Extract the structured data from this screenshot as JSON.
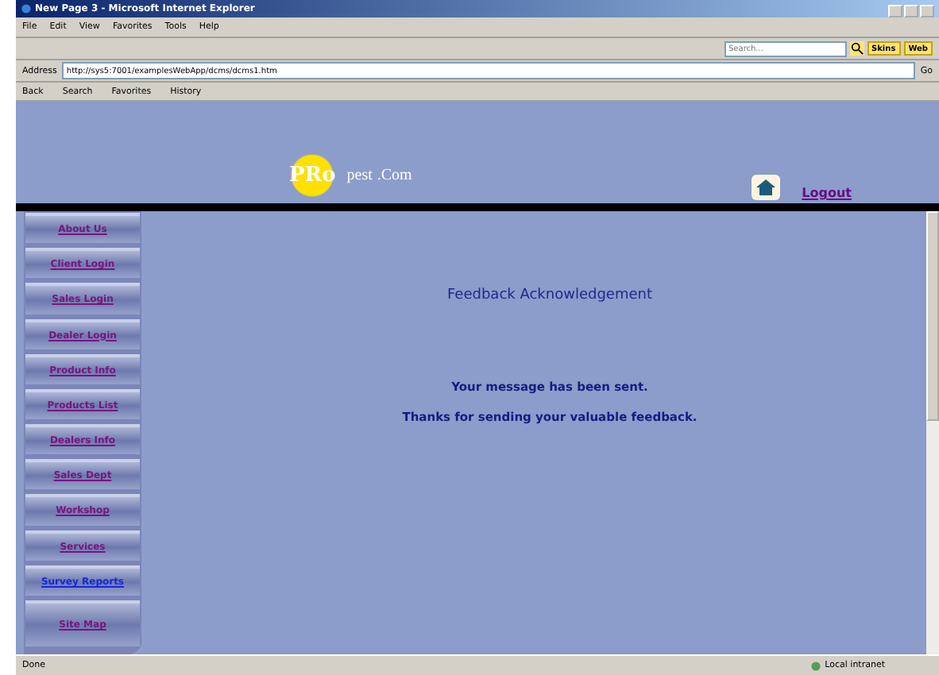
{
  "window": {
    "title": "New Page 3 - Microsoft Internet Explorer"
  },
  "menu": [
    "File",
    "Edit",
    "View",
    "Favorites",
    "Tools",
    "Help"
  ],
  "search_bar": {
    "placeholder": "Search...",
    "buttons": [
      "Skins",
      "Web"
    ]
  },
  "address_bar": {
    "label": "Address",
    "url": "http://sys5:7001/examplesWebApp/dcms/dcms1.htm",
    "go": "Go"
  },
  "toolbar": [
    "Back",
    "Search",
    "Favorites",
    "History"
  ],
  "site_header": {
    "logo_mark": "PRo",
    "logo_word": "pest",
    "logo_suffix": ".Com",
    "logout": "Logout"
  },
  "nav": [
    {
      "label": "About Us",
      "visited": false
    },
    {
      "label": "Client Login",
      "visited": false
    },
    {
      "label": "Sales Login",
      "visited": false
    },
    {
      "label": "Dealer Login",
      "visited": false
    },
    {
      "label": "Product Info",
      "visited": false
    },
    {
      "label": "Products List",
      "visited": false
    },
    {
      "label": "Dealers Info",
      "visited": false
    },
    {
      "label": "Sales Dept",
      "visited": false
    },
    {
      "label": "Workshop",
      "visited": false
    },
    {
      "label": "Services",
      "visited": false
    },
    {
      "label": "Survey Reports",
      "visited": true
    },
    {
      "label": "Site Map",
      "visited": false
    }
  ],
  "content": {
    "heading": "Feedback Acknowledgement",
    "messages": [
      "Your message has been sent.",
      "Thanks for sending your valuable feedback."
    ]
  },
  "status_bar": {
    "text": "Done",
    "zone": "Local intranet"
  }
}
